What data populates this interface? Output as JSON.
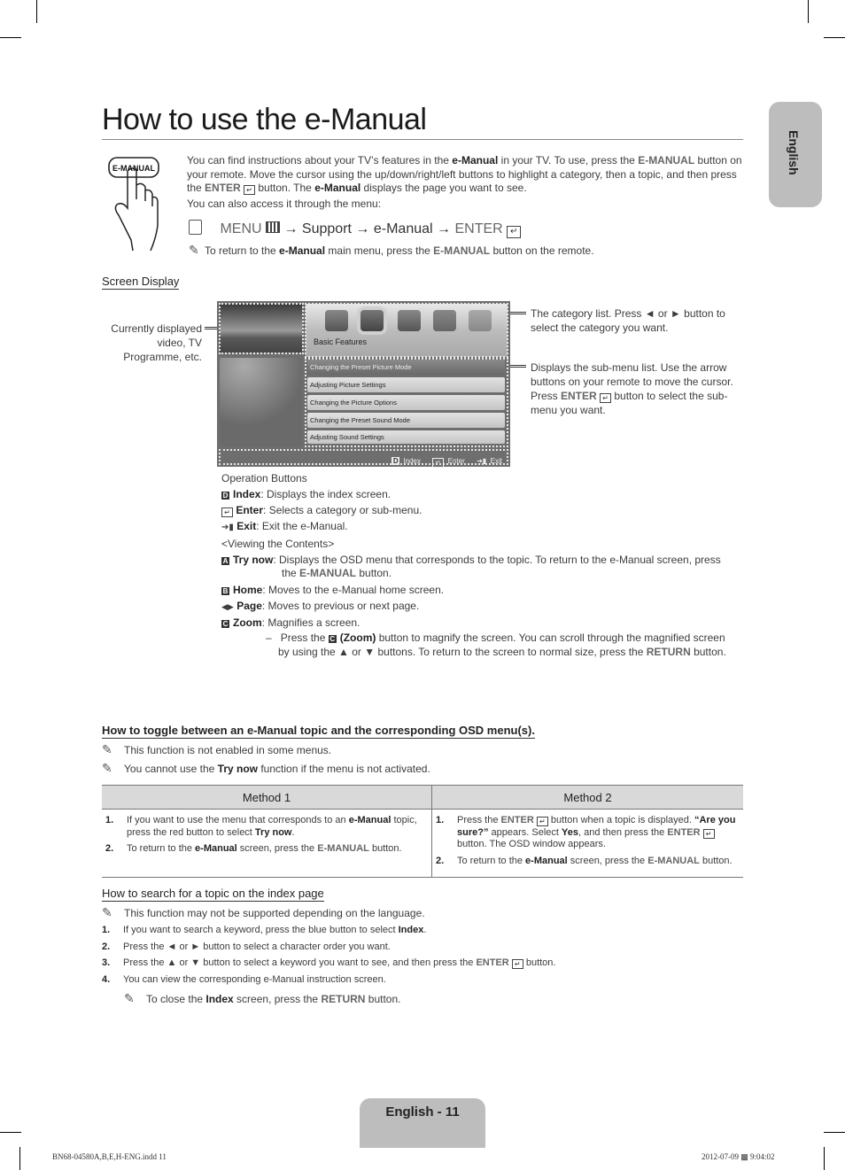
{
  "side_tab": {
    "label": "English"
  },
  "title": "How to use the e-Manual",
  "intro": {
    "button_icon_label": "E-MANUAL",
    "p1_a": "You can find instructions about your TV’s features in the ",
    "p1_b": "e-Manual",
    "p1_c": " in your TV. To use, press the ",
    "p1_d": "E-MANUAL",
    "p1_e": " button on your remote. Move the cursor using the up/down/right/left buttons to highlight a category, then a topic, and then press the ",
    "p1_f": "ENTER",
    "p1_g": " button. The ",
    "p1_h": "e-Manual",
    "p1_i": " displays the page you want to see.",
    "p2": "You can also access it through the menu:",
    "path_menu": "MENU",
    "path_arrow": "→",
    "path_support": "Support",
    "path_emanual": "e-Manual",
    "path_enter": "ENTER",
    "note_a": "To return to the ",
    "note_b": "e-Manual",
    "note_c": " main menu, press the ",
    "note_d": "E-MANUAL",
    "note_e": " button on the remote."
  },
  "screen_display": {
    "heading": "Screen Display",
    "left_callout": [
      "Currently displayed",
      "video, TV",
      "Programme, etc."
    ],
    "category_label": "Basic Features",
    "submenu_items": [
      "Changing the Preset Picture Mode",
      "Adjusting Picture Settings",
      "Changing the Picture Options",
      "Changing the Preset Sound Mode",
      "Adjusting Sound Settings"
    ],
    "op_bar": {
      "index": "Index",
      "enter": "Enter",
      "exit": "Exit"
    },
    "callout_category": "The category list. Press ◄ or ► button to select the category you want.",
    "callout_sub_a": "Displays the sub-menu list. Use the arrow buttons on your remote to move the cursor. Press ",
    "callout_sub_b": "ENTER",
    "callout_sub_c": " button to select the sub-menu you want."
  },
  "operation": {
    "heading": "Operation Buttons",
    "index_label": "Index",
    "index_desc": ": Displays the index screen.",
    "enter_label": "Enter",
    "enter_desc": ": Selects a category or sub-menu.",
    "exit_label": "Exit",
    "exit_desc": ": Exit the e-Manual.",
    "viewing": "<Viewing the Contents>",
    "trynow_label": "Try now",
    "trynow_desc": ": Displays the OSD menu that corresponds to the topic. To return to the e-Manual screen, press",
    "trynow_desc2_a": "the ",
    "trynow_desc2_b": "E-MANUAL",
    "trynow_desc2_c": " button.",
    "home_label": "Home",
    "home_desc": ": Moves to the e-Manual home screen.",
    "page_label": "Page",
    "page_desc": ": Moves to previous or next page.",
    "zoom_label": "Zoom",
    "zoom_desc": ": Magnifies a screen.",
    "zoom_sub_a": "Press the ",
    "zoom_sub_b": "(Zoom)",
    "zoom_sub_c": " button to magnify the screen. You can scroll through the magnified screen",
    "zoom_sub_d": "by using the ▲ or ▼ buttons. To return to the screen to normal size, press the ",
    "zoom_sub_e": "RETURN",
    "zoom_sub_f": " button."
  },
  "toggle": {
    "heading": "How to toggle between an e-Manual topic and the corresponding OSD menu(s).",
    "note1": "This function is not enabled in some menus.",
    "note2_a": "You cannot use the ",
    "note2_b": "Try now",
    "note2_c": " function if the menu is not activated.",
    "method1_header": "Method 1",
    "method2_header": "Method 2",
    "m1_1_a": "If you want to use the menu that corresponds to an ",
    "m1_1_b": "e-Manual",
    "m1_1_c": " topic, press the red button to select ",
    "m1_1_d": "Try now",
    "m1_1_e": ".",
    "m1_2_a": "To return to the ",
    "m1_2_b": "e-Manual",
    "m1_2_c": " screen, press the ",
    "m1_2_d": "E-MANUAL",
    "m1_2_e": " button.",
    "m2_1_a": "Press the ",
    "m2_1_b": "ENTER",
    "m2_1_c": " button when a topic is displayed. ",
    "m2_1_d": "“Are you sure?”",
    "m2_1_e": " appears. Select ",
    "m2_1_f": "Yes",
    "m2_1_g": ", and then press the ",
    "m2_1_h": "ENTER",
    "m2_1_i": " button. The OSD window appears.",
    "m2_2_a": "To return to the ",
    "m2_2_b": "e-Manual",
    "m2_2_c": " screen, press the ",
    "m2_2_d": "E-MANUAL",
    "m2_2_e": " button.",
    "num1": "1.",
    "num2": "2."
  },
  "search": {
    "heading": "How to search for a topic on the index page",
    "note": "This function may not be supported depending on the language.",
    "s1_a": "If you want to search a keyword, press the blue button to select ",
    "s1_b": "Index",
    "s1_c": ".",
    "s2": "Press the ◄ or ► button to select a character order you want.",
    "s3_a": "Press the ▲ or ▼ button to select a keyword you want to see, and then press the ",
    "s3_b": "ENTER",
    "s3_c": " button.",
    "s4": "You can view the corresponding e-Manual instruction screen.",
    "close_a": "To close the ",
    "close_b": "Index",
    "close_c": " screen, press the ",
    "close_d": "RETURN",
    "close_e": " button.",
    "nums": [
      "1.",
      "2.",
      "3.",
      "4."
    ]
  },
  "footer": {
    "page_label": "English - 11",
    "file": "BN68-04580A,B,E,H-ENG.indd   11",
    "timestamp": "2012-07-09   ▩ 9:04:02"
  },
  "icons": {
    "memo": "✎",
    "enter": "↵"
  }
}
